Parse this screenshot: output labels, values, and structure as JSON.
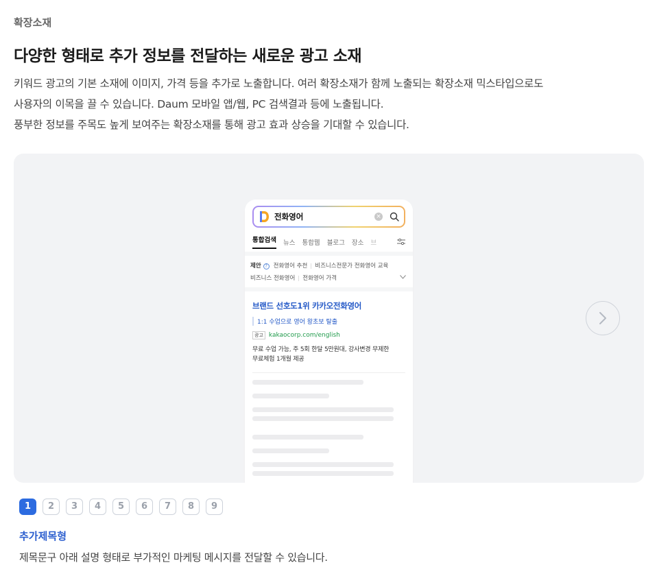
{
  "header": {
    "eyebrow": "확장소재",
    "title": "다양한 형태로 추가 정보를 전달하는 새로운 광고 소재",
    "description": [
      "키워드 광고의 기본 소재에 이미지, 가격 등을 추가로 노출합니다. 여러 확장소재가 함께 노출되는 확장소재 믹스타입으로도",
      "사용자의 이목을 끌 수 있습니다. Daum 모바일 앱/웹, PC 검색결과 등에 노출됩니다.",
      "풍부한 정보를 주목도 높게 보여주는 확장소재를 통해 광고 효과 상승을 기대할 수 있습니다."
    ]
  },
  "phone": {
    "search_query": "전화영어",
    "tabs": [
      "통합검색",
      "뉴스",
      "통합웹",
      "블로그",
      "장소",
      "브"
    ],
    "suggest": {
      "label": "제안",
      "items": [
        "전화영어 추천",
        "비즈니스전문가 전화영어 교육",
        "비즈니스 전화영어",
        "전화영어 가격"
      ]
    },
    "ad": {
      "title": "브랜드 선호도1위 카카오전화영어",
      "subtitle": "1:1 수업으로 영어 왕초보 탈출",
      "badge": "광고",
      "url": "kakaocorp.com/english",
      "description_lines": [
        "무료 수업 가능, 주 5회 한달 5만원대, 강사변경 무제한",
        "무료체험 1개월 제공"
      ]
    }
  },
  "carousel": {
    "pages": [
      "1",
      "2",
      "3",
      "4",
      "5",
      "6",
      "7",
      "8",
      "9"
    ],
    "active_page": "1"
  },
  "feature": {
    "title": "추가제목형",
    "description": "제목문구 아래 설명 형태로 부가적인 마케팅 메시지를 전달할 수 있습니다."
  },
  "colors": {
    "accent": "#2c6be0",
    "link_blue": "#2459c7",
    "url_green": "#1f9a4a",
    "stage_bg": "#f2f3f5"
  },
  "icons": [
    "daum-logo-icon",
    "clear-icon",
    "search-icon",
    "filter-icon",
    "help-icon",
    "chevron-down-icon",
    "chevron-right-icon"
  ]
}
